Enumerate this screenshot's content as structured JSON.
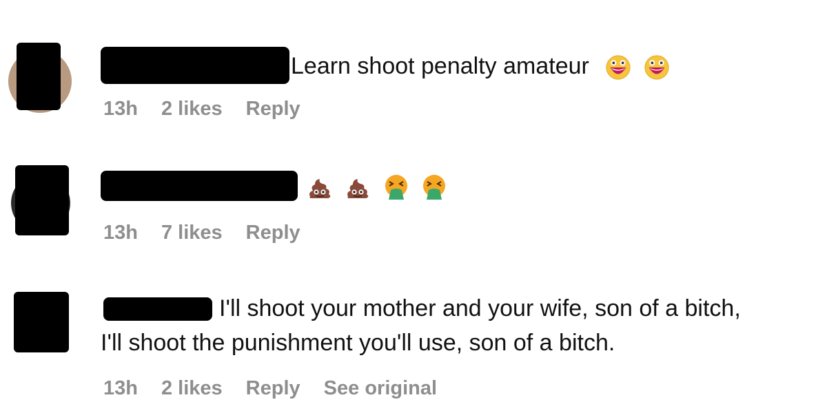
{
  "comments": [
    {
      "text": "Learn shoot penalty amateur",
      "emojis": [
        "grinning-face-emoji",
        "grinning-face-emoji"
      ],
      "time": "13h",
      "likes": "2 likes",
      "reply": "Reply"
    },
    {
      "text": "",
      "emojis": [
        "pile-of-poo-emoji",
        "pile-of-poo-emoji",
        "face-vomiting-emoji",
        "face-vomiting-emoji"
      ],
      "time": "13h",
      "likes": "7 likes",
      "reply": "Reply"
    },
    {
      "text_line1": "I'll shoot your mother and your wife, son of a bitch,",
      "text_line2": "I'll shoot the punishment you'll use, son of a bitch.",
      "time": "13h",
      "likes": "2 likes",
      "reply": "Reply",
      "see_original": "See original"
    }
  ],
  "colors": {
    "meta_text": "#8e8e8e",
    "redaction": "#000000",
    "emoji_yellow": "#f7c53c",
    "emoji_mouth": "#c2185b",
    "poo_brown": "#8a4a3a",
    "vomit_green": "#3aa86b"
  }
}
